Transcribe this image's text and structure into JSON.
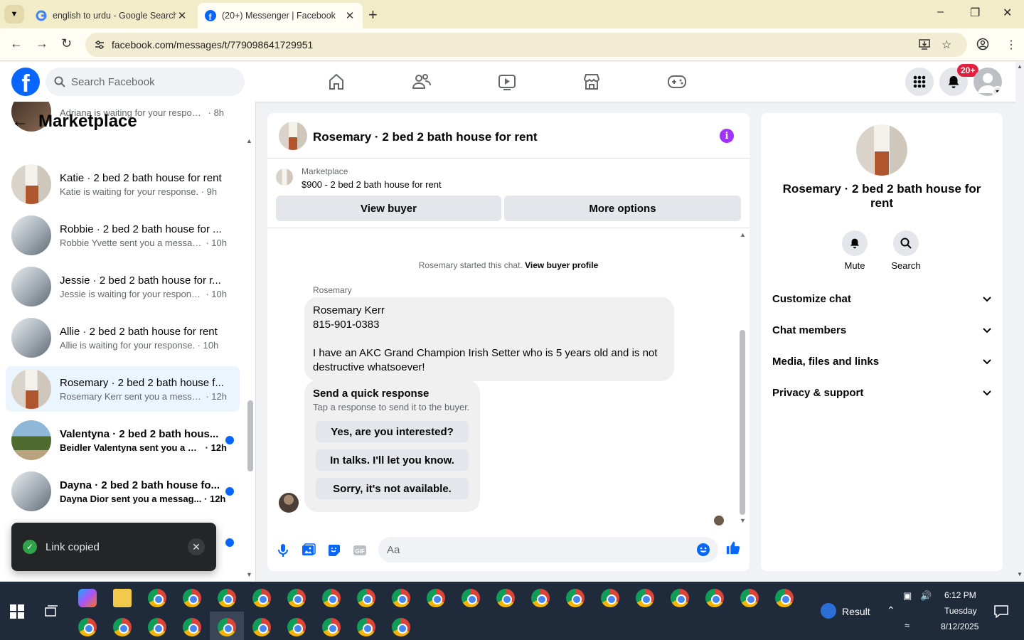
{
  "browser": {
    "tabs": [
      {
        "label": "english to urdu - Google Search",
        "active": false
      },
      {
        "label": "(20+) Messenger | Facebook",
        "active": true
      }
    ],
    "url": "facebook.com/messages/t/779098641729951"
  },
  "fb_header": {
    "search_placeholder": "Search Facebook",
    "notifications_badge": "20+"
  },
  "left_panel": {
    "title": "Marketplace",
    "conversations": [
      {
        "name": "",
        "preview": "Adriana is waiting for your response.",
        "time": "· 8h",
        "unread": false,
        "active": false
      },
      {
        "name": "Katie · 2 bed 2 bath house for rent",
        "preview": "Katie is waiting for your response.",
        "time": "· 9h",
        "unread": false,
        "active": false
      },
      {
        "name": "Robbie · 2 bed 2 bath house for ...",
        "preview": "Robbie Yvette sent you a message...",
        "time": "· 10h",
        "unread": false,
        "active": false
      },
      {
        "name": "Jessie · 2 bed 2 bath house for r...",
        "preview": "Jessie is waiting for your response.",
        "time": "· 10h",
        "unread": false,
        "active": false
      },
      {
        "name": "Allie · 2 bed 2 bath house for rent",
        "preview": "Allie is waiting for your response.",
        "time": "· 10h",
        "unread": false,
        "active": false
      },
      {
        "name": "Rosemary · 2 bed 2 bath house f...",
        "preview": "Rosemary Kerr sent you a messag...",
        "time": "· 12h",
        "unread": false,
        "active": true
      },
      {
        "name": "Valentyna · 2 bed 2 bath hous...",
        "preview": "Beidler Valentyna sent you a m...",
        "time": "· 12h",
        "unread": true,
        "active": false
      },
      {
        "name": "Dayna · 2 bed 2 bath house fo...",
        "preview": "Dayna Dior sent you a messag...",
        "time": "· 12h",
        "unread": true,
        "active": false
      }
    ],
    "toast": "Link copied"
  },
  "chat": {
    "title": "Rosemary · 2 bed 2 bath house for rent",
    "marketplace_label": "Marketplace",
    "listing": "$900 - 2 bed 2 bath house for rent",
    "view_buyer": "View buyer",
    "more_options": "More options",
    "started_text": "Rosemary started this chat.",
    "view_buyer_profile": "View buyer profile",
    "sender": "Rosemary",
    "message_lines": [
      "Rosemary Kerr",
      "815-901-0383",
      "",
      "I have an AKC Grand Champion Irish Setter who is 5 years old and is not destructive whatsoever!"
    ],
    "quick_response_title": "Send a quick response",
    "quick_response_sub": "Tap a response to send it to the buyer.",
    "quick_responses": [
      "Yes, are you interested?",
      "In talks. I'll let you know.",
      "Sorry, it's not available."
    ],
    "composer_placeholder": "Aa"
  },
  "right_panel": {
    "name": "Rosemary · 2 bed 2 bath house for rent",
    "mute": "Mute",
    "search": "Search",
    "sections": [
      "Customize chat",
      "Chat members",
      "Media, files and links",
      "Privacy & support"
    ]
  },
  "taskbar": {
    "tray_label": "Result",
    "time": "6:12 PM",
    "day": "Tuesday",
    "date": "8/12/2025"
  },
  "colors": {
    "fb_blue": "#0866ff",
    "unread_dot": "#0866ff",
    "info_purple": "#a033ff",
    "badge_red": "#e41e3f"
  }
}
